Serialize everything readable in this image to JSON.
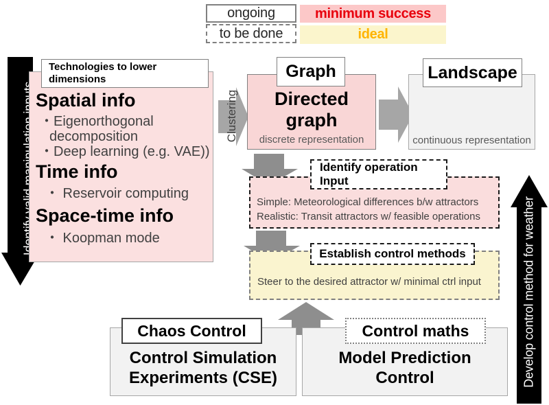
{
  "legend": {
    "status_items": [
      {
        "label": "ongoing",
        "style": "solid"
      },
      {
        "label": "to be done",
        "style": "dashed"
      }
    ],
    "goal_items": [
      {
        "label": "minimum success",
        "bg": "#fcc8c8",
        "color": "#e8000d"
      },
      {
        "label": "ideal",
        "bg": "#fbf5cc",
        "color": "#ffb400"
      }
    ]
  },
  "left_arrow": {
    "label": "Identify valid manipulation inputs",
    "color": "#000000"
  },
  "right_arrow": {
    "label": "Develop control method for weather",
    "color": "#000000"
  },
  "tech_panel": {
    "cap": "Technologies to lower dimensions",
    "sections": [
      {
        "heading": "Spatial info",
        "bullets": [
          "・Eigenorthogonal",
          "  decomposition",
          "・Deep learning (e.g. VAE))"
        ]
      },
      {
        "heading": "Time info",
        "bullets": [
          "・ Reservoir computing"
        ]
      },
      {
        "heading": "Space-time info",
        "bullets": [
          "・ Koopman mode"
        ]
      }
    ]
  },
  "clustering_arrow": {
    "label": "Clustering"
  },
  "graph_panel": {
    "cap": "Graph",
    "title_line1": "Directed",
    "title_line2": "graph",
    "caption": "discrete representation"
  },
  "landscape_panel": {
    "cap": "Landscape",
    "caption": "continuous representation"
  },
  "operation_panel": {
    "cap_line1": "Identify operation",
    "cap_line2": "Input",
    "line1": "Simple: Meteorological differences b/w attractors",
    "line2": "Realistic: Transit attractors w/ feasible operations"
  },
  "control_panel": {
    "cap": "Establish control methods",
    "line1": "Steer to the desired attractor w/ minimal ctrl input"
  },
  "chaos_panel": {
    "cap": "Chaos Control",
    "title_line1": "Control Simulation",
    "title_line2": "Experiments (CSE)"
  },
  "maths_panel": {
    "cap": "Control maths",
    "title_line1": "Model Prediction",
    "title_line2": "Control"
  },
  "icons": {
    "arrow_right": "arrow-right-icon",
    "arrow_down": "arrow-down-icon",
    "arrow_up": "arrow-up-icon"
  },
  "colors": {
    "pink_fill": "#fbe0e0",
    "pink_strong": "#f9d6d6",
    "yellow_fill": "#faf4cf",
    "gray_fill": "#f2f2f2",
    "arrow_gray": "#a6a6a6",
    "black": "#000000"
  }
}
